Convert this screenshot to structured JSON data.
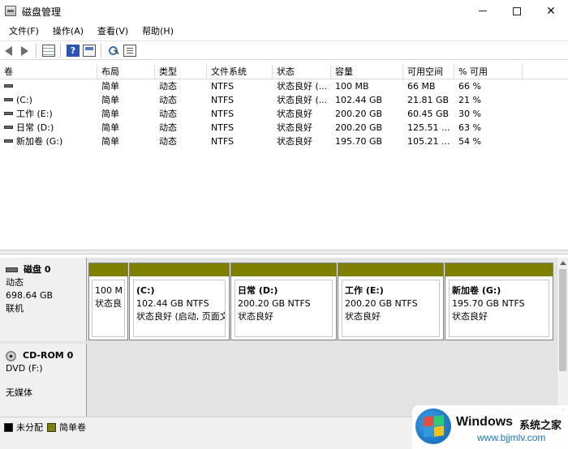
{
  "window": {
    "title": "磁盘管理"
  },
  "menu": [
    "文件(F)",
    "操作(A)",
    "查看(V)",
    "帮助(H)"
  ],
  "toolbar": {
    "help_glyph": "?"
  },
  "volume_table": {
    "columns": [
      "卷",
      "布局",
      "类型",
      "文件系统",
      "状态",
      "容量",
      "可用空间",
      "% 可用"
    ],
    "rows": [
      [
        "",
        "简单",
        "动态",
        "NTFS",
        "状态良好 (...",
        "100 MB",
        "66 MB",
        "66 %"
      ],
      [
        "(C:)",
        "简单",
        "动态",
        "NTFS",
        "状态良好 (...",
        "102.44 GB",
        "21.81 GB",
        "21 %"
      ],
      [
        "工作 (E:)",
        "简单",
        "动态",
        "NTFS",
        "状态良好",
        "200.20 GB",
        "60.45 GB",
        "30 %"
      ],
      [
        "日常 (D:)",
        "简单",
        "动态",
        "NTFS",
        "状态良好",
        "200.20 GB",
        "125.51 ...",
        "63 %"
      ],
      [
        "新加卷 (G:)",
        "简单",
        "动态",
        "NTFS",
        "状态良好",
        "195.70 GB",
        "105.21 ...",
        "54 %"
      ]
    ]
  },
  "disk0": {
    "name": "磁盘 0",
    "type": "动态",
    "size": "698.64 GB",
    "status": "联机",
    "partitions": [
      {
        "name": "",
        "size": "100 M",
        "status": "状态良"
      },
      {
        "name": "(C:)",
        "size": "102.44 GB NTFS",
        "status": "状态良好 (启动, 页面文"
      },
      {
        "name": "日常  (D:)",
        "size": "200.20 GB NTFS",
        "status": "状态良好"
      },
      {
        "name": "工作  (E:)",
        "size": "200.20 GB NTFS",
        "status": "状态良好"
      },
      {
        "name": "新加卷  (G:)",
        "size": "195.70 GB NTFS",
        "status": "状态良好"
      }
    ]
  },
  "cdrom0": {
    "name": "CD-ROM 0",
    "drive": "DVD (F:)",
    "media": "无媒体"
  },
  "legend": {
    "unallocated": "未分配",
    "simple": "简单卷",
    "unallocated_color": "#000000",
    "simple_color": "#808000"
  },
  "watermark": {
    "brand": "Windows",
    "cn": "系统之家",
    "url": "www.bjjmlv.com"
  }
}
